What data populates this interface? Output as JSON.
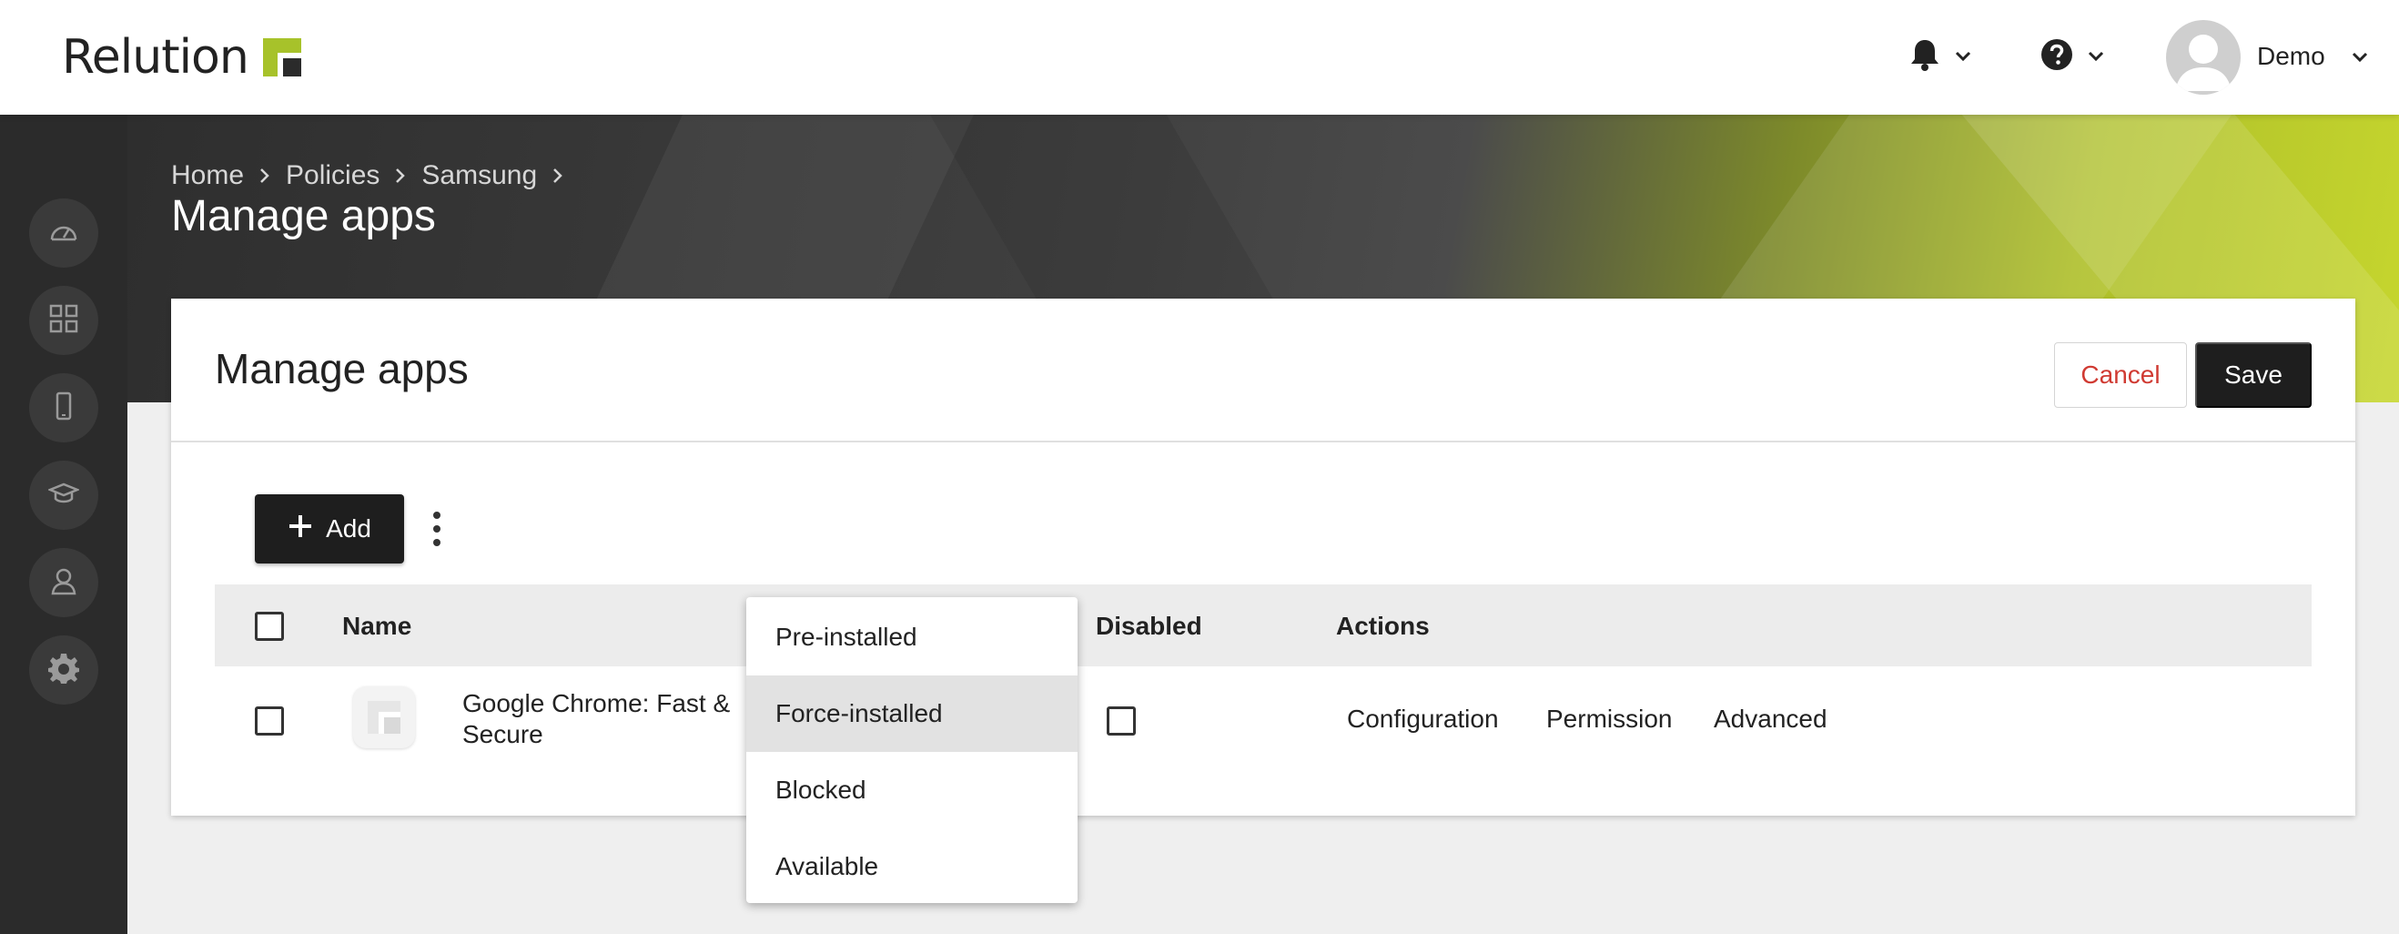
{
  "header": {
    "logo_text": "Relution",
    "user_name": "Demo",
    "accent_color": "#a7c22a"
  },
  "sidebar": {
    "items": [
      {
        "name": "dashboard"
      },
      {
        "name": "apps"
      },
      {
        "name": "devices"
      },
      {
        "name": "education"
      },
      {
        "name": "users"
      },
      {
        "name": "settings"
      }
    ]
  },
  "breadcrumb": {
    "items": [
      "Home",
      "Policies",
      "Samsung"
    ]
  },
  "page": {
    "title": "Manage apps"
  },
  "card": {
    "title": "Manage apps",
    "cancel_label": "Cancel",
    "save_label": "Save",
    "add_label": "Add"
  },
  "table": {
    "columns": {
      "name": "Name",
      "disabled": "Disabled",
      "actions": "Actions"
    },
    "rows": [
      {
        "app_name": "Google Chrome: Fast & Secure",
        "actions": [
          "Configuration",
          "Permission",
          "Advanced"
        ]
      }
    ]
  },
  "dropdown": {
    "options": [
      "Pre-installed",
      "Force-installed",
      "Blocked",
      "Available"
    ],
    "highlighted": "Force-installed"
  }
}
